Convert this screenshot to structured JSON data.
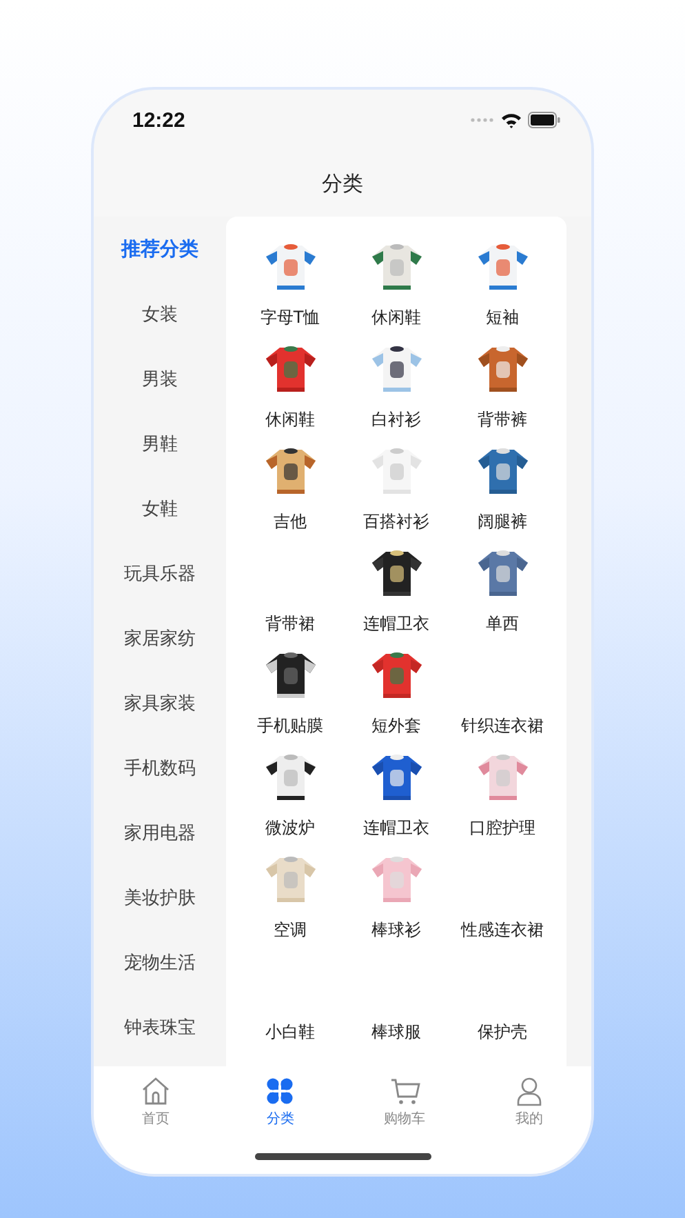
{
  "status_bar": {
    "time": "12:22"
  },
  "nav": {
    "title": "分类"
  },
  "sidebar": {
    "items": [
      {
        "label": "推荐分类",
        "selected": true
      },
      {
        "label": "女装",
        "selected": false
      },
      {
        "label": "男装",
        "selected": false
      },
      {
        "label": "男鞋",
        "selected": false
      },
      {
        "label": "女鞋",
        "selected": false
      },
      {
        "label": "玩具乐器",
        "selected": false
      },
      {
        "label": "家居家纺",
        "selected": false
      },
      {
        "label": "家具家装",
        "selected": false
      },
      {
        "label": "手机数码",
        "selected": false
      },
      {
        "label": "家用电器",
        "selected": false
      },
      {
        "label": "美妆护肤",
        "selected": false
      },
      {
        "label": "宠物生活",
        "selected": false
      },
      {
        "label": "钟表珠宝",
        "selected": false
      }
    ]
  },
  "products": [
    {
      "label": "字母T恤",
      "kind": "picture"
    },
    {
      "label": "休闲鞋",
      "kind": "picture"
    },
    {
      "label": "短袖",
      "kind": "picture"
    },
    {
      "label": "休闲鞋",
      "kind": "picture"
    },
    {
      "label": "白衬衫",
      "kind": "picture"
    },
    {
      "label": "背带裤",
      "kind": "picture"
    },
    {
      "label": "吉他",
      "kind": "picture"
    },
    {
      "label": "百搭衬衫",
      "kind": "picture"
    },
    {
      "label": "阔腿裤",
      "kind": "picture"
    },
    {
      "label": "背带裙",
      "kind": "text"
    },
    {
      "label": "连帽卫衣",
      "kind": "picture"
    },
    {
      "label": "单西",
      "kind": "picture"
    },
    {
      "label": "手机贴膜",
      "kind": "picture"
    },
    {
      "label": "短外套",
      "kind": "picture"
    },
    {
      "label": "针织连衣裙",
      "kind": "text"
    },
    {
      "label": "微波炉",
      "kind": "picture"
    },
    {
      "label": "连帽卫衣",
      "kind": "picture"
    },
    {
      "label": "口腔护理",
      "kind": "picture"
    },
    {
      "label": "空调",
      "kind": "picture"
    },
    {
      "label": "棒球衫",
      "kind": "picture"
    },
    {
      "label": "性感连衣裙",
      "kind": "text"
    },
    {
      "label": "小白鞋",
      "kind": "text"
    },
    {
      "label": "棒球服",
      "kind": "text"
    },
    {
      "label": "保护壳",
      "kind": "text"
    }
  ],
  "tab_bar": [
    {
      "label": "首页",
      "kind": "home",
      "selected": false
    },
    {
      "label": "分类",
      "kind": "category",
      "selected": true
    },
    {
      "label": "购物车",
      "kind": "cart",
      "selected": false
    },
    {
      "label": "我的",
      "kind": "profile",
      "selected": false
    }
  ]
}
